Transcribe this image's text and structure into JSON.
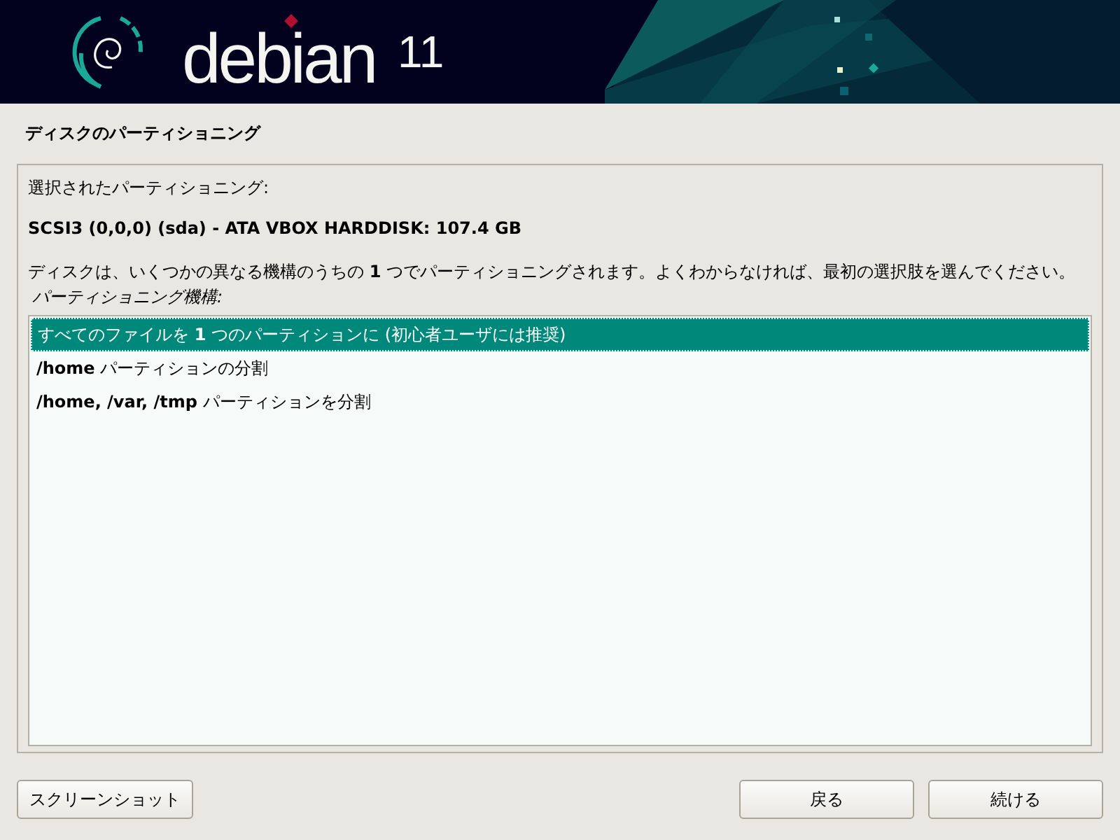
{
  "banner": {
    "logo_text": "debian",
    "version": "11"
  },
  "page_title": "ディスクのパーティショニング",
  "panel": {
    "heading": "選択されたパーティショニング:",
    "disk": "SCSI3 (0,0,0) (sda) - ATA VBOX HARDDISK: 107.4 GB",
    "description": "ディスクは、いくつかの異なる機構のうちの **1** つでパーティショニングされます。よくわからなければ、最初の選択肢を選んでください。",
    "list_label": "パーティショニング機構:",
    "options": [
      {
        "label": "すべてのファイルを **1** つのパーティションに (初心者ユーザには推奨)",
        "selected": true
      },
      {
        "label": "**/home** パーティションの分割",
        "selected": false
      },
      {
        "label": "**/home, /var, /tmp** パーティションを分割",
        "selected": false
      }
    ]
  },
  "buttons": {
    "screenshot": "スクリーンショット",
    "back": "戻る",
    "continue": "続ける"
  }
}
